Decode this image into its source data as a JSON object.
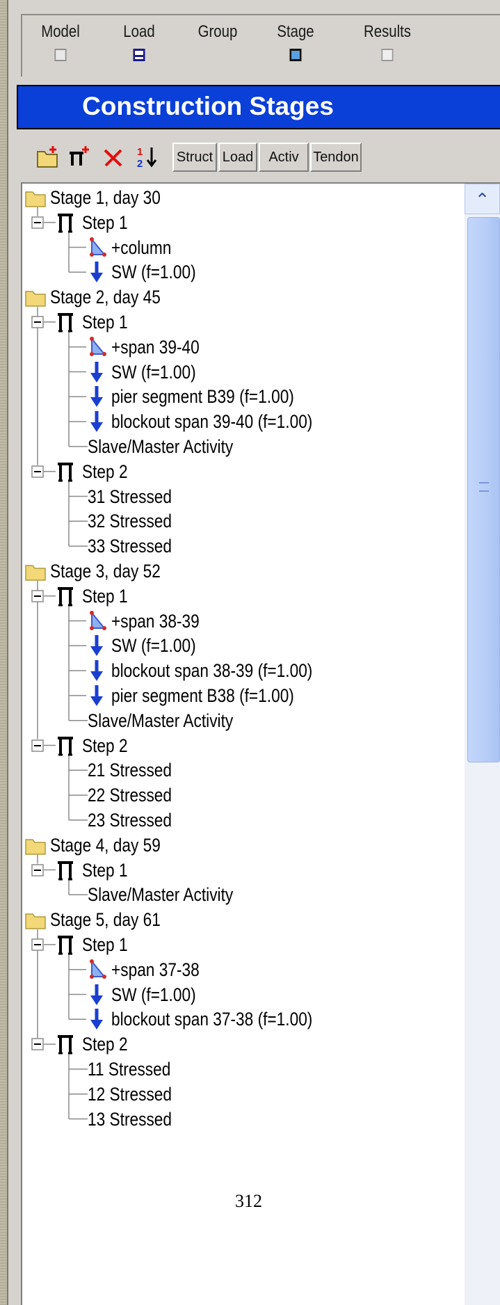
{
  "toolbar_top": {
    "buttons": [
      {
        "label": "Model",
        "icon": "model-icon"
      },
      {
        "label": "Load",
        "icon": "load-icon"
      },
      {
        "label": "Group",
        "icon": "group-icon"
      },
      {
        "label": "Stage",
        "icon": "stage-icon"
      },
      {
        "label": "Results",
        "icon": "results-icon"
      }
    ]
  },
  "title": "Construction Stages",
  "toolbar": {
    "icons": [
      "new-stage-icon",
      "new-step-icon",
      "delete-icon",
      "sort-icon"
    ],
    "tabs": [
      "Struct",
      "Load",
      "Activ",
      "Tendon"
    ]
  },
  "tree": {
    "stages": [
      {
        "label": "Stage 1, day 30",
        "steps": [
          {
            "label": "Step 1",
            "items": [
              {
                "label": "+column",
                "kind": "element"
              },
              {
                "label": "SW (f=1.00)",
                "kind": "load"
              }
            ]
          }
        ]
      },
      {
        "label": "Stage 2, day 45",
        "steps": [
          {
            "label": "Step 1",
            "items": [
              {
                "label": "+span 39-40",
                "kind": "element"
              },
              {
                "label": "SW (f=1.00)",
                "kind": "load"
              },
              {
                "label": "pier segment B39 (f=1.00)",
                "kind": "load"
              },
              {
                "label": "blockout span 39-40 (f=1.00)",
                "kind": "load"
              },
              {
                "label": "Slave/Master Activity",
                "kind": "activity"
              }
            ]
          },
          {
            "label": "Step 2",
            "items": [
              {
                "label": "31 Stressed",
                "kind": "tendon"
              },
              {
                "label": "32 Stressed",
                "kind": "tendon"
              },
              {
                "label": "33 Stressed",
                "kind": "tendon"
              }
            ]
          }
        ]
      },
      {
        "label": "Stage 3, day 52",
        "steps": [
          {
            "label": "Step 1",
            "items": [
              {
                "label": "+span 38-39",
                "kind": "element"
              },
              {
                "label": "SW (f=1.00)",
                "kind": "load"
              },
              {
                "label": "blockout span 38-39 (f=1.00)",
                "kind": "load"
              },
              {
                "label": "pier segment B38 (f=1.00)",
                "kind": "load"
              },
              {
                "label": "Slave/Master Activity",
                "kind": "activity"
              }
            ]
          },
          {
            "label": "Step 2",
            "items": [
              {
                "label": "21 Stressed",
                "kind": "tendon"
              },
              {
                "label": "22 Stressed",
                "kind": "tendon"
              },
              {
                "label": "23 Stressed",
                "kind": "tendon"
              }
            ]
          }
        ]
      },
      {
        "label": "Stage 4, day 59",
        "steps": [
          {
            "label": "Step 1",
            "items": [
              {
                "label": "Slave/Master Activity",
                "kind": "activity"
              }
            ]
          }
        ]
      },
      {
        "label": "Stage 5, day 61",
        "steps": [
          {
            "label": "Step 1",
            "items": [
              {
                "label": "+span 37-38",
                "kind": "element"
              },
              {
                "label": "SW (f=1.00)",
                "kind": "load"
              },
              {
                "label": "blockout span 37-38 (f=1.00)",
                "kind": "load"
              }
            ]
          },
          {
            "label": "Step 2",
            "items": [
              {
                "label": "11 Stressed",
                "kind": "tendon"
              },
              {
                "label": "12 Stressed",
                "kind": "tendon"
              },
              {
                "label": "13 Stressed",
                "kind": "tendon"
              }
            ]
          }
        ]
      }
    ]
  },
  "page_number": "312",
  "colors": {
    "title_bar": "#0a3fd8",
    "panel": "#d6d3ce",
    "load_arrow": "#1a3fd0",
    "element_icon": "#d42a2a",
    "folder": "#f2d878"
  }
}
